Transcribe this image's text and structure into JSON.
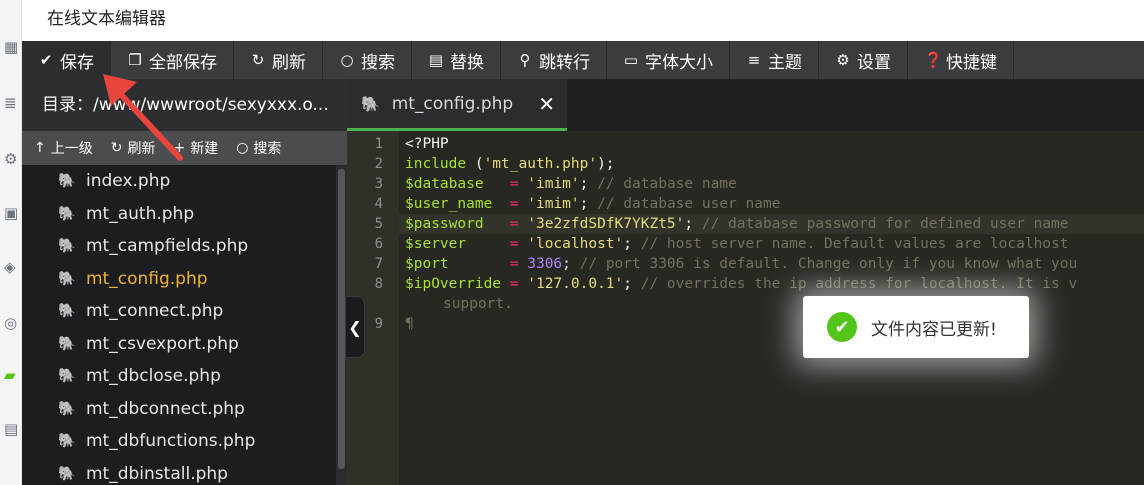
{
  "window": {
    "title": "在线文本编辑器"
  },
  "toolbar": {
    "buttons": [
      {
        "label": "保存",
        "icon": "check-icon"
      },
      {
        "label": "全部保存",
        "icon": "copy-icon"
      },
      {
        "label": "刷新",
        "icon": "refresh-icon"
      },
      {
        "label": "搜索",
        "icon": "search-icon"
      },
      {
        "label": "替换",
        "icon": "replace-icon"
      },
      {
        "label": "跳转行",
        "icon": "jump-icon"
      },
      {
        "label": "字体大小",
        "icon": "font-size-icon"
      },
      {
        "label": "主题",
        "icon": "menu-icon"
      },
      {
        "label": "设置",
        "icon": "gear-icon"
      },
      {
        "label": "快捷键",
        "icon": "help-icon"
      }
    ]
  },
  "sidebar": {
    "path": "目录：/www/wwwroot/sexyxxx.o...",
    "actions": [
      {
        "label": "上一级",
        "icon": "arrow-up-icon"
      },
      {
        "label": "刷新",
        "icon": "refresh-icon"
      },
      {
        "label": "新建",
        "icon": "plus-icon"
      },
      {
        "label": "搜索",
        "icon": "search-icon"
      }
    ],
    "files": [
      "index.php",
      "mt_auth.php",
      "mt_campfields.php",
      "mt_config.php",
      "mt_connect.php",
      "mt_csvexport.php",
      "mt_dbclose.php",
      "mt_dbconnect.php",
      "mt_dbfunctions.php",
      "mt_dbinstall.php"
    ],
    "current_file": "mt_config.php"
  },
  "editor": {
    "tab_label": "mt_config.php",
    "close_glyph": "✕",
    "line_numbers": [
      "1",
      "2",
      "3",
      "4",
      "5",
      "6",
      "7",
      "8",
      "9"
    ],
    "lines": {
      "l1": "<?PHP",
      "l2_kw": "include",
      "l2_str": "'mt_auth.php'",
      "l2_rest": ");",
      "l3_var": "$database",
      "l3_str": "'imim'",
      "l3_cm": "// database name",
      "l4_var": "$user_name",
      "l4_str": "'imim'",
      "l4_cm": "// database user name",
      "l5_var": "$password",
      "l5_str": "'3e2zfdSDfK7YKZt5'",
      "l5_cm": "// database password for defined user name",
      "l6_var": "$server",
      "l6_str": "'localhost'",
      "l6_cm": "// host server name. Default values are localhost",
      "l7_var": "$port",
      "l7_num": "3306",
      "l7_cm": "// port 3306 is default. Change only if you know what you",
      "l8_var": "$ipOverride",
      "l8_str": "'127.0.0.1'",
      "l8_cm": "// overrides the ip address for localhost. It is v",
      "l8_cont": "support.",
      "l9": "¶"
    }
  },
  "toast": {
    "message": "文件内容已更新!"
  },
  "colors": {
    "accent": "#4caf50",
    "current_file": "#f0b429",
    "annotation": "#e8453c"
  }
}
